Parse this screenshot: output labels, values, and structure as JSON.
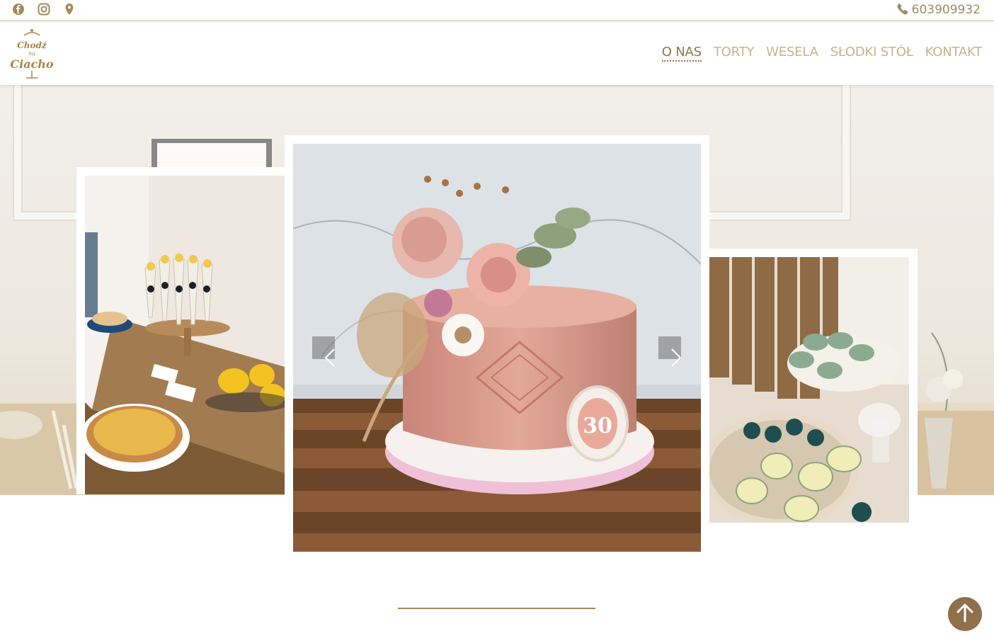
{
  "topbar": {
    "social": [
      {
        "icon": "facebook-icon"
      },
      {
        "icon": "instagram-icon"
      },
      {
        "icon": "map-pin-icon"
      }
    ],
    "phone_icon": "phone-icon",
    "phone": "603909932"
  },
  "header": {
    "logo_text": [
      "Chodź",
      "na",
      "Ciacho"
    ],
    "nav": [
      {
        "label": "O NAS",
        "active": true
      },
      {
        "label": "TORTY",
        "active": false
      },
      {
        "label": "WESELA",
        "active": false
      },
      {
        "label": "SŁODKI STÓŁ",
        "active": false
      },
      {
        "label": "KONTAKT",
        "active": false
      }
    ]
  },
  "carousel": {
    "slides": [
      {
        "name": "dessert-table-photo",
        "position": "left"
      },
      {
        "name": "pink-cake-photo",
        "position": "center",
        "cake_number": "30"
      },
      {
        "name": "cakesicles-photo",
        "position": "right"
      }
    ],
    "prev_icon": "chevron-left-icon",
    "next_icon": "chevron-right-icon"
  },
  "colors": {
    "accent": "#a08a5f",
    "nav_inactive": "#c8b38e",
    "nav_active": "#8f7650",
    "scroll_button": "#8f704a"
  },
  "scroll_top_icon": "arrow-up-icon"
}
